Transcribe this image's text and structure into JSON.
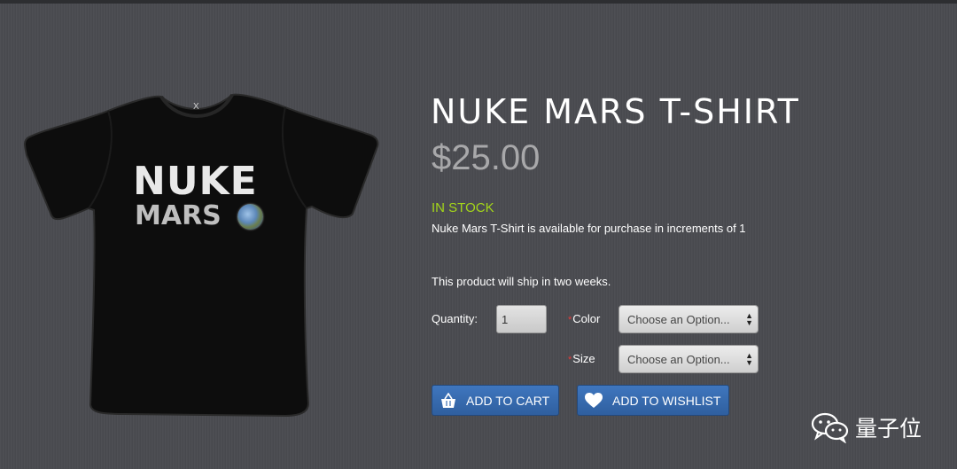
{
  "product": {
    "title": "NUKE MARS T-SHIRT",
    "price": "$25.00",
    "stock_status": "IN STOCK",
    "availability": "Nuke Mars T-Shirt is available for purchase in increments of 1",
    "shipping_note": "This product will ship in two weeks.",
    "image": {
      "line1": "NUKE",
      "line2": "MARS",
      "neck_logo": "X"
    }
  },
  "form": {
    "quantity_label": "Quantity:",
    "quantity_value": "1",
    "required_mark": "*",
    "color_label": "Color",
    "color_selected": "Choose an Option...",
    "size_label": "Size",
    "size_selected": "Choose an Option..."
  },
  "actions": {
    "add_to_cart": "ADD TO CART",
    "add_to_wishlist": "ADD TO WISHLIST"
  },
  "watermark": {
    "text": "量子位",
    "icon": "wechat-icon"
  },
  "colors": {
    "background": "#4a4b50",
    "stock": "#a4d61a",
    "price": "#a8a8aa",
    "button": "#3a6db2",
    "required": "#e23b3b"
  }
}
